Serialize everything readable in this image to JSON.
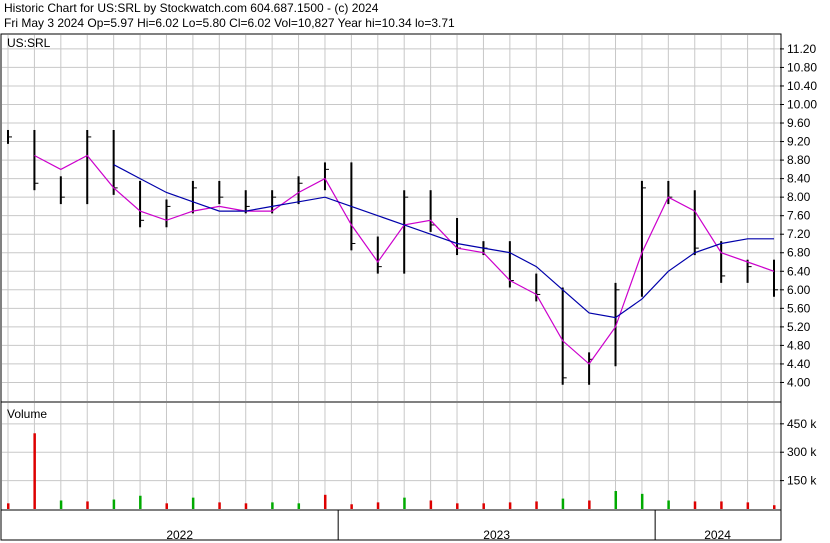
{
  "header": {
    "line1": "Historic Chart for US:SRL by Stockwatch.com 604.687.1500 - (c) 2024",
    "line2": "Fri May  3 2024  Op=5.97  Hi=6.02  Lo=5.80  Cl=6.02  Vol=10,827  Year hi=10.34  lo=3.71"
  },
  "colors": {
    "bars": "#000000",
    "ma_short": "#cc00cc",
    "ma_long": "#0000aa",
    "vol_up": "#00aa00",
    "vol_down": "#dd0000",
    "grid": "#c8c8c8"
  },
  "chart_data": [
    {
      "type": "line",
      "subtype": "ohlc-price",
      "label": "US:SRL",
      "y_scale": "linear",
      "ylim": [
        3.6,
        11.5
      ],
      "yticks": [
        "11.20",
        "10.80",
        "10.40",
        "10.00",
        "9.60",
        "9.20",
        "8.80",
        "8.40",
        "8.00",
        "7.60",
        "7.20",
        "6.80",
        "6.40",
        "6.00",
        "5.60",
        "5.20",
        "4.80",
        "4.40",
        "4.00"
      ],
      "x_labels": [
        "2022",
        "2023",
        "2024"
      ],
      "grid": true,
      "series": [
        {
          "role": "price",
          "x": [
            "2021-12",
            "2022-01",
            "2022-02",
            "2022-03",
            "2022-04",
            "2022-05",
            "2022-06",
            "2022-07",
            "2022-08",
            "2022-09",
            "2022-10",
            "2022-11",
            "2022-12",
            "2023-01",
            "2023-02",
            "2023-03",
            "2023-04",
            "2023-05",
            "2023-06",
            "2023-07",
            "2023-08",
            "2023-09",
            "2023-10",
            "2023-11",
            "2023-12",
            "2024-01",
            "2024-02",
            "2024-03",
            "2024-04",
            "2024-05"
          ],
          "values": [
            9.3,
            8.3,
            8.0,
            9.3,
            8.2,
            7.5,
            7.8,
            8.2,
            8.0,
            7.8,
            8.0,
            8.3,
            8.6,
            7.0,
            6.5,
            8.0,
            7.4,
            6.9,
            6.9,
            6.2,
            5.9,
            4.1,
            4.5,
            6.0,
            8.2,
            8.0,
            6.9,
            6.3,
            6.5,
            6.0
          ]
        },
        {
          "role": "moving-average-short",
          "x": [
            "2021-12",
            "2022-01",
            "2022-02",
            "2022-03",
            "2022-04",
            "2022-05",
            "2022-06",
            "2022-07",
            "2022-08",
            "2022-09",
            "2022-10",
            "2022-11",
            "2022-12",
            "2023-01",
            "2023-02",
            "2023-03",
            "2023-04",
            "2023-05",
            "2023-06",
            "2023-07",
            "2023-08",
            "2023-09",
            "2023-10",
            "2023-11",
            "2023-12",
            "2024-01",
            "2024-02",
            "2024-03",
            "2024-04",
            "2024-05"
          ],
          "values": [
            null,
            8.9,
            8.6,
            8.9,
            8.2,
            7.7,
            7.5,
            7.7,
            7.8,
            7.7,
            7.7,
            8.1,
            8.4,
            7.4,
            6.6,
            7.4,
            7.5,
            6.9,
            6.8,
            6.2,
            5.9,
            4.9,
            4.4,
            5.2,
            6.8,
            8.0,
            7.7,
            6.8,
            6.6,
            6.4
          ]
        },
        {
          "role": "moving-average-long",
          "x": [
            "2021-12",
            "2022-01",
            "2022-02",
            "2022-03",
            "2022-04",
            "2022-05",
            "2022-06",
            "2022-07",
            "2022-08",
            "2022-09",
            "2022-10",
            "2022-11",
            "2022-12",
            "2023-01",
            "2023-02",
            "2023-03",
            "2023-04",
            "2023-05",
            "2023-06",
            "2023-07",
            "2023-08",
            "2023-09",
            "2023-10",
            "2023-11",
            "2023-12",
            "2024-01",
            "2024-02",
            "2024-03",
            "2024-04",
            "2024-05"
          ],
          "values": [
            null,
            null,
            null,
            null,
            8.7,
            8.4,
            8.1,
            7.9,
            7.7,
            7.7,
            7.8,
            7.9,
            8.0,
            7.8,
            7.6,
            7.4,
            7.2,
            7.0,
            6.9,
            6.8,
            6.5,
            6.0,
            5.5,
            5.4,
            5.8,
            6.4,
            6.8,
            7.0,
            7.1,
            7.1
          ]
        }
      ]
    },
    {
      "type": "bar",
      "subtype": "volume",
      "label": "Volume",
      "yticks": [
        "450 k",
        "300 k",
        "150 k"
      ],
      "ylim": [
        0,
        560
      ],
      "units": "k",
      "x": [
        "2021-12",
        "2022-01",
        "2022-02",
        "2022-03",
        "2022-04",
        "2022-05",
        "2022-06",
        "2022-07",
        "2022-08",
        "2022-09",
        "2022-10",
        "2022-11",
        "2022-12",
        "2023-01",
        "2023-02",
        "2023-03",
        "2023-04",
        "2023-05",
        "2023-06",
        "2023-07",
        "2023-08",
        "2023-09",
        "2023-10",
        "2023-11",
        "2023-12",
        "2024-01",
        "2024-02",
        "2024-03",
        "2024-04",
        "2024-05"
      ],
      "values": [
        30,
        400,
        45,
        40,
        50,
        70,
        30,
        60,
        35,
        30,
        35,
        30,
        75,
        25,
        35,
        60,
        45,
        30,
        30,
        35,
        40,
        55,
        45,
        95,
        80,
        45,
        40,
        40,
        35,
        20
      ],
      "direction": [
        "down",
        "down",
        "up",
        "down",
        "up",
        "up",
        "down",
        "up",
        "down",
        "down",
        "up",
        "up",
        "down",
        "down",
        "down",
        "up",
        "down",
        "down",
        "down",
        "down",
        "down",
        "up",
        "down",
        "up",
        "up",
        "up",
        "down",
        "down",
        "down",
        "down"
      ]
    }
  ]
}
